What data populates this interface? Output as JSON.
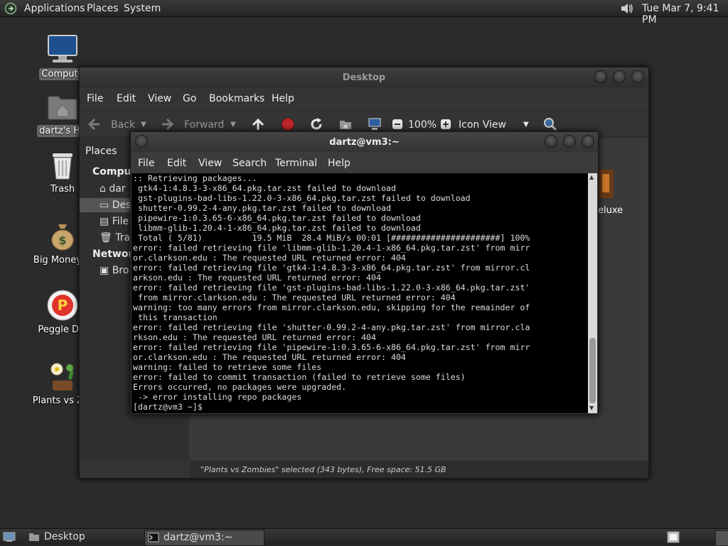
{
  "top_panel": {
    "menus": [
      "Applications",
      "Places",
      "System"
    ],
    "clock": "Tue Mar 7, 9:41 PM"
  },
  "desktop_icons": [
    {
      "label": "Compute",
      "icon": "computer-icon",
      "selected": true
    },
    {
      "label": "dartz's Ho",
      "icon": "home-folder-icon",
      "selected": true
    },
    {
      "label": "Trash",
      "icon": "trash-icon",
      "selected": false
    },
    {
      "label": "Big Money D",
      "icon": "money-bag-icon",
      "selected": false
    },
    {
      "label": "Peggle Del",
      "icon": "peggle-icon",
      "selected": false
    },
    {
      "label": "Plants vs Zor",
      "icon": "plants-vs-zombies-icon",
      "selected": false
    }
  ],
  "file_manager": {
    "title": "Desktop",
    "menu": [
      "File",
      "Edit",
      "View",
      "Go",
      "Bookmarks",
      "Help"
    ],
    "toolbar": {
      "back": "Back",
      "forward": "Forward",
      "zoom": "100%",
      "view_mode": "Icon View"
    },
    "sidebar": {
      "header": "Places",
      "section_computer": "Compute",
      "items": [
        {
          "label": "dar",
          "icon": "home-icon"
        },
        {
          "label": "Des",
          "icon": "desktop-icon"
        },
        {
          "label": "File",
          "icon": "filesystem-icon"
        },
        {
          "label": "Tra",
          "icon": "trash-icon"
        }
      ],
      "section_network": "Network",
      "network_items": [
        {
          "label": "Bro",
          "icon": "browse-network-icon"
        }
      ]
    },
    "main_partial_label": "eluxe",
    "status": "\"Plants vs Zombies\" selected (343 bytes), Free space: 51.5 GB"
  },
  "terminal": {
    "title": "dartz@vm3:~",
    "menu": [
      "File",
      "Edit",
      "View",
      "Search",
      "Terminal",
      "Help"
    ],
    "lines": [
      ":: Retrieving packages...",
      " gtk4-1:4.8.3-3-x86_64.pkg.tar.zst failed to download",
      " gst-plugins-bad-libs-1.22.0-3-x86_64.pkg.tar.zst failed to download",
      " shutter-0.99.2-4-any.pkg.tar.zst failed to download",
      " pipewire-1:0.3.65-6-x86_64.pkg.tar.zst failed to download",
      " libmm-glib-1.20.4-1-x86_64.pkg.tar.zst failed to download",
      " Total ( 5/81)          19.5 MiB  28.4 MiB/s 00:01 [######################] 100%",
      "error: failed retrieving file 'libmm-glib-1.20.4-1-x86_64.pkg.tar.zst' from mirr",
      "or.clarkson.edu : The requested URL returned error: 404",
      "error: failed retrieving file 'gtk4-1:4.8.3-3-x86_64.pkg.tar.zst' from mirror.cl",
      "arkson.edu : The requested URL returned error: 404",
      "error: failed retrieving file 'gst-plugins-bad-libs-1.22.0-3-x86_64.pkg.tar.zst'",
      " from mirror.clarkson.edu : The requested URL returned error: 404",
      "warning: too many errors from mirror.clarkson.edu, skipping for the remainder of",
      " this transaction",
      "error: failed retrieving file 'shutter-0.99.2-4-any.pkg.tar.zst' from mirror.cla",
      "rkson.edu : The requested URL returned error: 404",
      "error: failed retrieving file 'pipewire-1:0.3.65-6-x86_64.pkg.tar.zst' from mirr",
      "or.clarkson.edu : The requested URL returned error: 404",
      "warning: failed to retrieve some files",
      "error: failed to commit transaction (failed to retrieve some files)",
      "Errors occurred, no packages were upgraded.",
      " -> error installing repo packages",
      "[dartz@vm3 ~]$ "
    ]
  },
  "taskbar": {
    "tasks": [
      {
        "label": "Desktop",
        "icon": "file-manager-icon",
        "active": false
      },
      {
        "label": "dartz@vm3:~",
        "icon": "terminal-icon",
        "active": true
      }
    ]
  },
  "colors": {
    "panel": "#2e2e2e",
    "terminal_bg": "#000000",
    "terminal_fg": "#dcdcdc",
    "window_bg": "#343434",
    "record_red": "#c0272d"
  }
}
